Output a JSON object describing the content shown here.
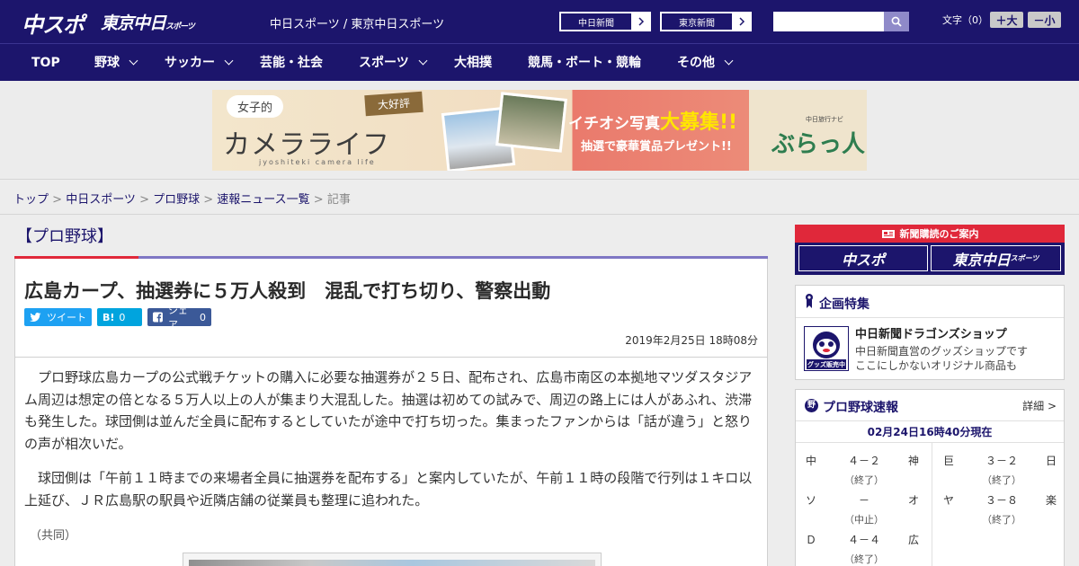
{
  "header": {
    "logo_main": "中スポ",
    "logo_tokyo": "東京中日",
    "logo_tokyo_sub": "スポーツ",
    "site_names": "中日スポーツ / 東京中日スポーツ",
    "paper_links": [
      "中日新聞",
      "東京新聞"
    ],
    "search_placeholder": "",
    "fontsize_label": "文字（0）",
    "font_larger": "＋大",
    "font_smaller": "－小"
  },
  "nav": [
    {
      "label": "TOP",
      "has_menu": false
    },
    {
      "label": "野球",
      "has_menu": true
    },
    {
      "label": "サッカー",
      "has_menu": true
    },
    {
      "label": "芸能・社会",
      "has_menu": false
    },
    {
      "label": "スポーツ",
      "has_menu": true
    },
    {
      "label": "大相撲",
      "has_menu": false
    },
    {
      "label": "競馬・ボート・競輪",
      "has_menu": false
    },
    {
      "label": "その他",
      "has_menu": true
    }
  ],
  "banner": {
    "joshi": "女子的",
    "camera_life": "カメラライフ",
    "roman": "jyoshiteki camera life",
    "daikohyo": "大好評",
    "ichioshi": "イチオシ写真",
    "daiboshu": "大募集!!",
    "chusen": "抽選で豪華賞品プレゼント!!",
    "navi": "中日旅行ナビ",
    "brand": "ぶらっ人"
  },
  "breadcrumb": {
    "items": [
      "トップ",
      "中日スポーツ",
      "プロ野球",
      "速報ニュース一覧"
    ],
    "current": "記事"
  },
  "article": {
    "category": "【プロ野球】",
    "headline": "広島カープ、抽選券に５万人殺到　混乱で打ち切り、警察出動",
    "share": {
      "tweet_label": "ツイート",
      "hatena_icon": "B!",
      "hatena_count": "0",
      "facebook_label": "シェア",
      "facebook_count": "0"
    },
    "date": "2019年2月25日 18時08分",
    "paragraphs": [
      "プロ野球広島カープの公式戦チケットの購入に必要な抽選券が２５日、配布され、広島市南区の本拠地マツダスタジアム周辺は想定の倍となる５万人以上の人が集まり大混乱した。抽選は初めての試みで、周辺の路上には人があふれ、渋滞も発生した。球団側は並んだ全員に配布するとしていたが途中で打ち切った。集まったファンからは「話が違う」と怒りの声が相次いだ。",
      "球団側は「午前１１時までの来場者全員に抽選券を配布する」と案内していたが、午前１１時の段階で行列は１キロ以上延び、ＪＲ広島駅の駅員や近隣店舗の従業員も整理に追われた。"
    ],
    "credit": "（共同）"
  },
  "sidebar": {
    "subscribe_head": "新聞購読のご案内",
    "subscribe_chuspo": "中スポ",
    "subscribe_tokyo": "東京中日",
    "subscribe_tokyo_sub": "スポーツ",
    "feature_head": "企画特集",
    "feature_thumb_text": "グッズ販売中",
    "feature_title": "中日新聞ドラゴンズショップ",
    "feature_desc": [
      "中日新聞直営のグッズショップです",
      "ここにしかないオリジナル商品も"
    ],
    "scores_head": "プロ野球速報",
    "scores_badge": "野",
    "scores_more": "詳細 >",
    "scores_time": "02月24日16時40分現在",
    "games": [
      {
        "home": "中",
        "score": "４－２",
        "away": "神",
        "status": "（終了）"
      },
      {
        "home": "巨",
        "score": "３－２",
        "away": "日",
        "status": "（終了）"
      },
      {
        "home": "ソ",
        "score": "－",
        "away": "オ",
        "status": "（中止）"
      },
      {
        "home": "ヤ",
        "score": "３－８",
        "away": "楽",
        "status": "（終了）"
      },
      {
        "home": "Ｄ",
        "score": "４－４",
        "away": "広",
        "status": "（終了）"
      }
    ]
  },
  "colors": {
    "brand_navy": "#1c156c",
    "accent_red": "#e0283a",
    "accent_purple": "#7f77c4",
    "twitter": "#1da1f2",
    "hatena": "#00a4de",
    "facebook": "#3b5998"
  }
}
